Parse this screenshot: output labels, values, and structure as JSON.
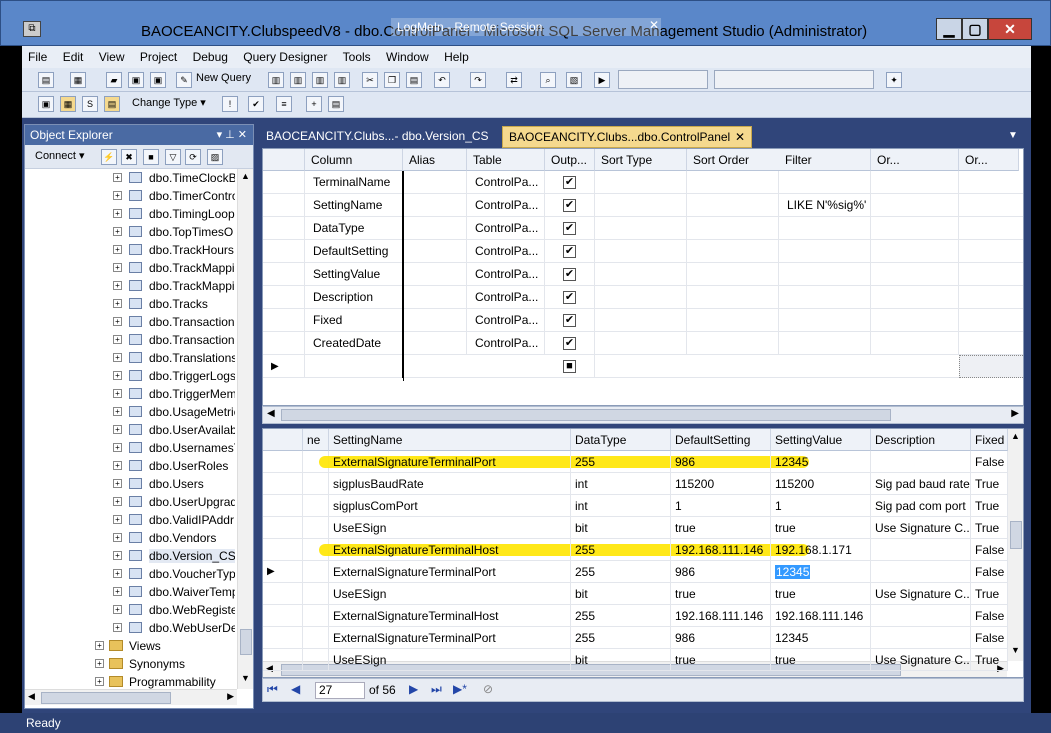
{
  "window": {
    "title": "BAOCEANCITY.ClubspeedV8 - dbo.ControlPanel - Microsoft SQL Server Management Studio (Administrator)",
    "overlay": "LogMeIn - Remote Session",
    "overlay_close": "✕",
    "min": "▁",
    "max": "▢",
    "close": "✕"
  },
  "menu": [
    "File",
    "Edit",
    "View",
    "Project",
    "Debug",
    "Query Designer",
    "Tools",
    "Window",
    "Help"
  ],
  "toolbar1": {
    "new_query": "New Query"
  },
  "toolbar2": {
    "change_type": "Change Type ▾"
  },
  "object_explorer": {
    "title": "Object Explorer",
    "pin": "▾ ⊥ ✕",
    "connect": "Connect ▾",
    "tables": [
      "dbo.TimeClockB",
      "dbo.TimerContro",
      "dbo.TimingLoop",
      "dbo.TopTimesO",
      "dbo.TrackHoursI",
      "dbo.TrackMappi",
      "dbo.TrackMappi",
      "dbo.Tracks",
      "dbo.Transaction",
      "dbo.Transaction",
      "dbo.Translations",
      "dbo.TriggerLogs",
      "dbo.TriggerMem",
      "dbo.UsageMetric",
      "dbo.UserAvailab",
      "dbo.UsernamesT",
      "dbo.UserRoles",
      "dbo.Users",
      "dbo.UserUpgrad",
      "dbo.ValidIPAddr",
      "dbo.Vendors",
      "dbo.Version_CS",
      "dbo.VoucherTyp",
      "dbo.WaiverTemp",
      "dbo.WebRegiste",
      "dbo.WebUserDe"
    ],
    "folders": [
      "Views",
      "Synonyms",
      "Programmability"
    ]
  },
  "tabs": [
    "BAOCEANCITY.Clubs...- dbo.Version_CS",
    "BAOCEANCITY.Clubs...dbo.ControlPanel"
  ],
  "tab_close": "✕",
  "criteria": {
    "headers": [
      "Column",
      "Alias",
      "Table",
      "Outp...",
      "Sort Type",
      "Sort Order",
      "Filter",
      "Or...",
      "Or..."
    ],
    "rows": [
      {
        "column": "TerminalName",
        "table": "ControlPa...",
        "filter": ""
      },
      {
        "column": "SettingName",
        "table": "ControlPa...",
        "filter": "LIKE N'%sig%'"
      },
      {
        "column": "DataType",
        "table": "ControlPa...",
        "filter": ""
      },
      {
        "column": "DefaultSetting",
        "table": "ControlPa...",
        "filter": ""
      },
      {
        "column": "SettingValue",
        "table": "ControlPa...",
        "filter": ""
      },
      {
        "column": "Description",
        "table": "ControlPa...",
        "filter": ""
      },
      {
        "column": "Fixed",
        "table": "ControlPa...",
        "filter": ""
      },
      {
        "column": "CreatedDate",
        "table": "ControlPa...",
        "filter": ""
      }
    ]
  },
  "results": {
    "headers": [
      "ne",
      "SettingName",
      "DataType",
      "DefaultSetting",
      "SettingValue",
      "Description",
      "Fixed"
    ],
    "rows": [
      {
        "name": "ExternalSignatureTerminalPort",
        "type": "255",
        "default": "986",
        "value": "12345",
        "desc": "",
        "fixed": "False"
      },
      {
        "name": "sigplusBaudRate",
        "type": "int",
        "default": "115200",
        "value": "115200",
        "desc": "Sig pad baud rate",
        "fixed": "True"
      },
      {
        "name": "sigplusComPort",
        "type": "int",
        "default": "1",
        "value": "1",
        "desc": "Sig pad com port",
        "fixed": "True"
      },
      {
        "name": "UseESign",
        "type": "bit",
        "default": "true",
        "value": "true",
        "desc": "Use Signature C...",
        "fixed": "True"
      },
      {
        "name": "ExternalSignatureTerminalHost",
        "type": "255",
        "default": "192.168.111.146",
        "value": "192.168.1.171",
        "desc": "",
        "fixed": "False"
      },
      {
        "name": "ExternalSignatureTerminalPort",
        "type": "255",
        "default": "986",
        "value": "12345",
        "desc": "",
        "fixed": "False"
      },
      {
        "name": "UseESign",
        "type": "bit",
        "default": "true",
        "value": "true",
        "desc": "Use Signature C...",
        "fixed": "True"
      },
      {
        "name": "ExternalSignatureTerminalHost",
        "type": "255",
        "default": "192.168.111.146",
        "value": "192.168.111.146",
        "desc": "",
        "fixed": "False"
      },
      {
        "name": "ExternalSignatureTerminalPort",
        "type": "255",
        "default": "986",
        "value": "12345",
        "desc": "",
        "fixed": "False"
      },
      {
        "name": "UseESign",
        "type": "bit",
        "default": "true",
        "value": "true",
        "desc": "Use Signature C...",
        "fixed": "True"
      }
    ]
  },
  "nav": {
    "record": "27",
    "of": "of 56"
  },
  "status": "Ready",
  "colors": {
    "title": "#5a87c9",
    "highlight": "#ffe600",
    "tab_active": "#f5d98e"
  }
}
